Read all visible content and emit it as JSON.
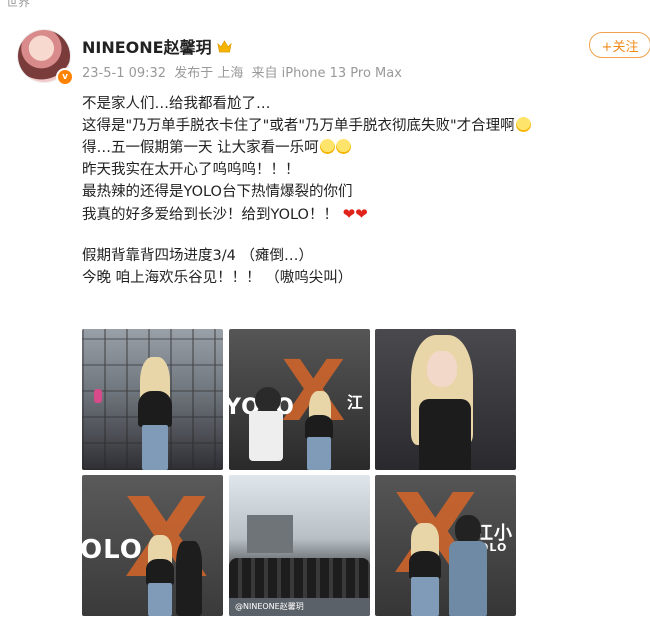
{
  "top_partial_text": "世界",
  "post": {
    "username": "NINEONE赵馨玥",
    "meta": {
      "date": "23-5-1 09:32",
      "location": "发布于 上海",
      "device": "来自 iPhone 13 Pro Max"
    },
    "follow_label": "+关注",
    "lines": [
      "不是家人们…给我都看尬了…",
      "这得是\"乃万单手脱衣卡住了\"或者\"乃万单手脱衣彻底失败\"才合理啊",
      "得…五一假期第一天 让大家看一乐呵",
      "昨天我实在太开心了呜呜呜！！！",
      "最热辣的还得是YOLO台下热情爆裂的你们",
      "我真的好多爱给到长沙！给到YOLO！！",
      "假期背靠背四场进度3/4 （瘫倒…）",
      "今晚 咱上海欢乐谷见！！！ （嗷呜尖叫）"
    ],
    "hearts": "❤❤",
    "photos": [
      {
        "name": "photo-1"
      },
      {
        "name": "photo-2",
        "overlay": "YOLO",
        "side": "江"
      },
      {
        "name": "photo-3"
      },
      {
        "name": "photo-4",
        "overlay": "OLO"
      },
      {
        "name": "photo-5",
        "caption": "@NINEONE赵馨玥"
      },
      {
        "name": "photo-6",
        "overlay": "江小",
        "sub": "OLO"
      }
    ]
  },
  "colors": {
    "accent": "#f08a1a",
    "verified": "#ff8200",
    "meta_text": "#999999"
  }
}
